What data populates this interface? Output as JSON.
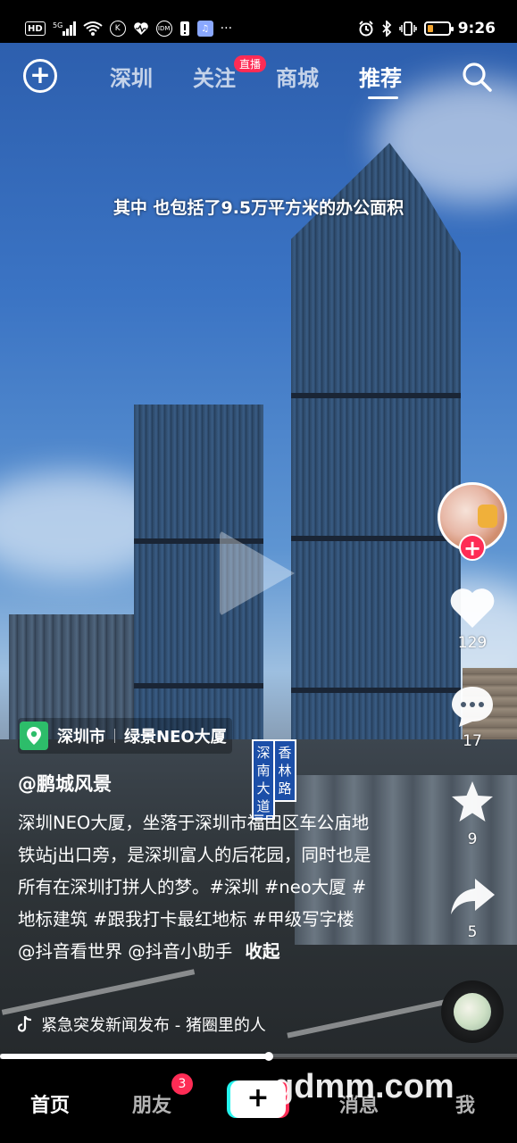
{
  "status_bar": {
    "hd": "HD",
    "network": "5G",
    "time": "9:26",
    "battery_level": 0.3,
    "dots": "···"
  },
  "top_nav": {
    "tabs": [
      {
        "label": "深圳",
        "active": false
      },
      {
        "label": "关注",
        "active": false
      },
      {
        "label": "商城",
        "active": false
      },
      {
        "label": "推荐",
        "active": true
      }
    ],
    "live_badge": "直播",
    "add_icon": "plus-circle-icon",
    "search_icon": "search-icon"
  },
  "video": {
    "caption": "其中 也包括了9.5万平方米的办公面积",
    "progress": 0.52,
    "building_sign_left": "深南大道",
    "building_sign_right": "香林路"
  },
  "right_rail": {
    "likes": "129",
    "comments": "17",
    "favorites": "9",
    "shares": "5",
    "follow_icon": "plus-icon",
    "like_icon": "heart-icon",
    "comment_icon": "comment-icon",
    "favorite_icon": "star-icon",
    "share_icon": "share-arrow-icon"
  },
  "info": {
    "location_city": "深圳市",
    "location_place": "绿景NEO大厦",
    "author": "@鹏城风景",
    "description": "深圳NEO大厦，坐落于深圳市福田区车公庙地铁站j出口旁，是深圳富人的后花园，同时也是所有在深圳打拼人的梦。#深圳 #neo大厦 #地标建筑 #跟我打卡最红地标 #甲级写字楼 @抖音看世界 @抖音小助手",
    "collapse": "收起",
    "music": "紧急突发新闻发布 - 猪圈里的人"
  },
  "bottom_nav": {
    "items": [
      {
        "label": "首页",
        "active": true
      },
      {
        "label": "朋友",
        "active": false
      },
      {
        "label": "消息",
        "active": false
      },
      {
        "label": "我",
        "active": false
      }
    ],
    "friends_badge": "3",
    "create_label": "+"
  },
  "watermark": "gdmm.com",
  "colors": {
    "accent": "#fe2c55",
    "location_pin": "#2dbd6a"
  }
}
